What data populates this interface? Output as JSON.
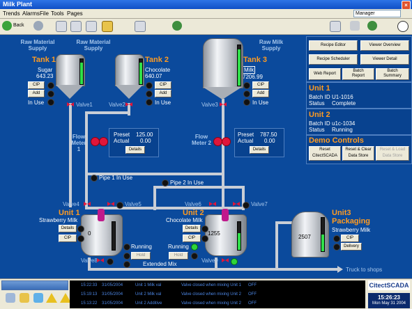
{
  "window": {
    "title": "Milk Plant",
    "close": "×"
  },
  "menu": {
    "items": [
      "Trends",
      "Alarms",
      "File",
      "Tools",
      "Pages"
    ],
    "user": "Manager"
  },
  "toolbar": {
    "back": "Back"
  },
  "supply": {
    "raw_material": "Raw Material\nSupply",
    "raw_material_2": "Raw Material\nSupply",
    "raw_milk": "Raw Milk\nSupply"
  },
  "tank1": {
    "title": "Tank 1",
    "product": "Sugar",
    "value": "643.23",
    "cip": "CIP",
    "add": "Add",
    "status": "In Use",
    "valve": "Valve1"
  },
  "tank2": {
    "title": "Tank 2",
    "product": "Chocolate",
    "value": "640.07",
    "cip": "CIP",
    "add": "Add",
    "status": "In Use",
    "valve": "Valve2"
  },
  "tank3": {
    "title": "Tank 3",
    "product": "Milk",
    "value": "7206.99",
    "cip": "CIP",
    "add": "Add",
    "status": "In Use",
    "valve": "Valve3"
  },
  "flow1": {
    "label": "Flow\nMeter 1",
    "preset_label": "Preset",
    "preset": "125.00",
    "actual_label": "Actual",
    "actual": "0.00",
    "details": "Details"
  },
  "flow2": {
    "label": "Flow\nMeter 2",
    "preset_label": "Preset",
    "preset": "787.50",
    "actual_label": "Actual",
    "actual": "0.00",
    "details": "Details"
  },
  "pipes": {
    "pipe1": "Pipe 1 In Use",
    "pipe2": "Pipe 2 In Use"
  },
  "unit1": {
    "title": "Unit 1",
    "product": "Strawberry Milk",
    "details": "Details",
    "cip": "CIP",
    "level": "0",
    "running": "Running",
    "hold": "Hold",
    "valve_in": "Valve4",
    "valve_in2": "Valve5",
    "valve_out": "Valve8"
  },
  "unit2": {
    "title": "Unit 2",
    "product": "Chocolate Milk",
    "details": "Details",
    "cip": "CIP",
    "level": "1255",
    "running": "Running",
    "hold": "Hold",
    "extended": "Extended Mix",
    "valve_in": "Valve6",
    "valve_in2": "Valve7",
    "valve_out": "Valve9"
  },
  "unit3": {
    "title": "Unit3\nPackaging",
    "product": "Strawberry Milk",
    "level": "2507",
    "cip": "CIP",
    "delivery": "Delivery"
  },
  "truck": "Truck to shops",
  "right_panel": {
    "buttons": [
      "Recipe Editor",
      "Viewer Overview",
      "Recipe Scheduler",
      "Viewer Detail",
      "Web Report",
      "Batch\nReport",
      "Batch\nSummary"
    ],
    "unit1": {
      "title": "Unit 1",
      "batch_label": "Batch ID",
      "batch": "U1-1016",
      "status_label": "Status",
      "status": "Complete"
    },
    "unit2": {
      "title": "Unit 2",
      "batch_label": "Batch ID",
      "batch": "u1c-1034",
      "status_label": "Status",
      "status": "Running"
    },
    "demo": {
      "title": "Demo Controls",
      "btn1": "Reset\nCitectSCADA",
      "btn2": "Reset & Clear\nData Store",
      "btn3": "Reset & Load\nData Store"
    }
  },
  "alarms": [
    {
      "time": "15:22:33",
      "date": "31/05/2004",
      "source": "Unit 1 Milk val",
      "desc": "Valve closed when mixing Unit 1",
      "state": "OFF"
    },
    {
      "time": "15:19:13",
      "date": "31/05/2004",
      "source": "Unit 2 Milk val",
      "desc": "Valve closed when mixing Unit 2",
      "state": "OFF"
    },
    {
      "time": "15:13:22",
      "date": "31/05/2004",
      "source": "Unit 2 Additive",
      "desc": "Valve closed when mixing Unit 2",
      "state": "OFF"
    }
  ],
  "brand": {
    "name": "CitectSCADA",
    "time": "15:26:23",
    "date": "Mon May 31 2004"
  },
  "colors": {
    "accent": "#ff9b21",
    "background": "#0b4a9c",
    "valve": "#e0163a",
    "running": "#2fd43a"
  },
  "levels": {
    "tank1": 0.85,
    "tank2": 0.85,
    "tank3": 0.9,
    "unit1": 0.0,
    "unit2": 0.6,
    "unit3": 0.5
  }
}
